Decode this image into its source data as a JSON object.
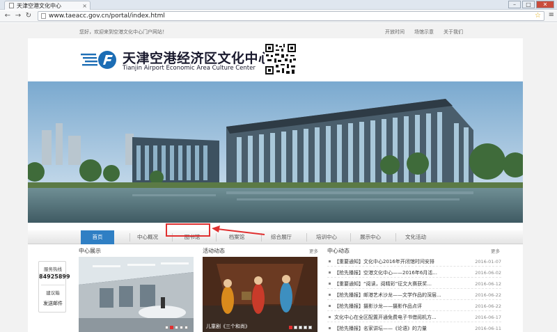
{
  "browser": {
    "tab_title": "天津空港文化中心",
    "tab_close": "×",
    "url": "www.taeacc.gov.cn/portal/index.html",
    "win_min": "–",
    "win_max": "□",
    "win_close": "✕"
  },
  "topbar": {
    "welcome": "您好，欢迎来到空港文化中心门户网站！",
    "links": [
      "开放时间",
      "场馆示意",
      "关于我们"
    ]
  },
  "header": {
    "name_cn": "天津空港经济区文化中心",
    "name_en": "Tianjin Airport Economic Area Culture Center"
  },
  "nav": {
    "items": [
      "首页",
      "中心概况",
      "图书馆",
      "档案馆",
      "综合展厅",
      "培训中心",
      "展示中心",
      "文化活动"
    ],
    "active": 0,
    "highlighted": 2
  },
  "sections": {
    "center_title": "中心展示",
    "activity_title": "活动动态",
    "activity_more": "更多",
    "news_title": "中心动态",
    "news_more": "更多"
  },
  "service": {
    "hotline_label": "服务热线",
    "hotline_number": "84925899",
    "suggest_label": "建议箱",
    "mail_label": "发送邮件"
  },
  "activity_caption": "儿童剧《三个和尚》",
  "news": [
    {
      "title": "【重要通知】文化中心2016年开闭馆时间安排",
      "date": "2016-01-07"
    },
    {
      "title": "【抢先播报】空港文化中心——2016年6月活...",
      "date": "2016-06-02"
    },
    {
      "title": "【重要通知】“阅读，阅精彩”征文大赛获奖...",
      "date": "2016-06-12"
    },
    {
      "title": "【抢先播报】邮港艺术沙龙——文学作品的深层...",
      "date": "2016-06-22"
    },
    {
      "title": "【抢先播报】摄影沙龙——摄影作品点评",
      "date": "2016-06-22"
    },
    {
      "title": "文化中心在全区配置开通免费电子书借阅机方...",
      "date": "2016-06-17"
    },
    {
      "title": "【抢先播报】名家讲坛——《论语》的力量",
      "date": "2016-06-11"
    }
  ],
  "colors": {
    "nav_active": "#2f7fc4",
    "highlight": "#e03030",
    "logo_blue": "#1c6db5"
  }
}
